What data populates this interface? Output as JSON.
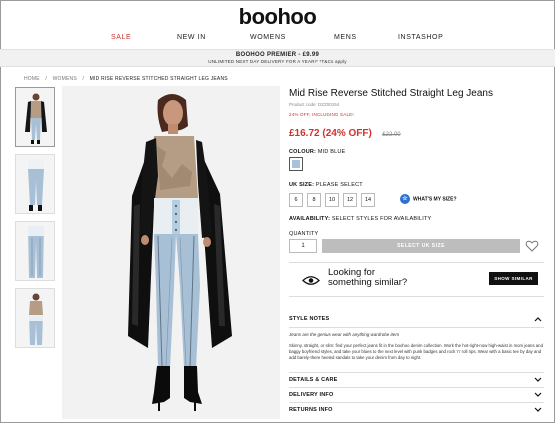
{
  "brand": {
    "logo_text": "boohoo"
  },
  "nav": {
    "items": [
      {
        "label": "SALE"
      },
      {
        "label": "NEW IN"
      },
      {
        "label": "WOMENS"
      },
      {
        "label": "MENS"
      },
      {
        "label": "INSTASHOP"
      }
    ]
  },
  "promo": {
    "line1": "BOOHOO PREMIER - £9.99",
    "line2": "UNLIMITED NEXT DAY DELIVERY FOR A YEAR!* *T&Cs apply"
  },
  "breadcrumb": [
    "HOME",
    "/",
    "WOMENS",
    "/",
    "MID RISE REVERSE STITCHED STRAIGHT LEG JEANS"
  ],
  "product": {
    "title": "Mid Rise Reverse Stitched Straight Leg Jeans",
    "code": "Product code: DZZ00154",
    "discount_note": "24% OFF, INCLUDING SALE!",
    "price": "£16.72 (24% OFF)",
    "was_price": "£22.00",
    "colour_label": "COLOUR:",
    "colour_value": "MID BLUE",
    "swatch_color": "#a9c2d9",
    "size_label": "UK SIZE:",
    "size_value": "PLEASE SELECT",
    "sizes": [
      "6",
      "8",
      "10",
      "12",
      "14"
    ],
    "whats_my_size": "WHAT'S MY SIZE?",
    "availability_label": "AVAILABILITY:",
    "availability_value": "SELECT STYLES FOR AVAILABILITY",
    "quantity_label": "QUANTITY",
    "quantity_value": "1",
    "add_button": "SELECT UK SIZE"
  },
  "similar": {
    "text_line1": "Looking for",
    "text_line2": "something similar?",
    "button": "SHOW SIMILAR"
  },
  "accordion": {
    "style_notes": "STYLE NOTES",
    "style_tagline": "Jeans are the genius wear with anything wardrobe item",
    "style_body": "Skinny, straight, or slim: find your perfect jeans fit in the boohoo denim collection. Work the hot-right-now high-waist in mom jeans and baggy boyfriend styles, and take your blues to the next level with punk badges and rock 'n' roll rips. Wear with a basic tee by day and add barely-there heeled sandals to take your denim from day to night.",
    "details": "DETAILS & CARE",
    "delivery": "DELIVERY INFO",
    "returns": "RETURNS INFO"
  },
  "colors": {
    "sale_red": "#d0322c",
    "accent_blue": "#2b6fd1",
    "denim": "#a9c2d9"
  },
  "icons": [
    "eye-icon",
    "heart-icon",
    "chevron-up-icon",
    "chevron-down-icon",
    "size-guide-icon"
  ]
}
